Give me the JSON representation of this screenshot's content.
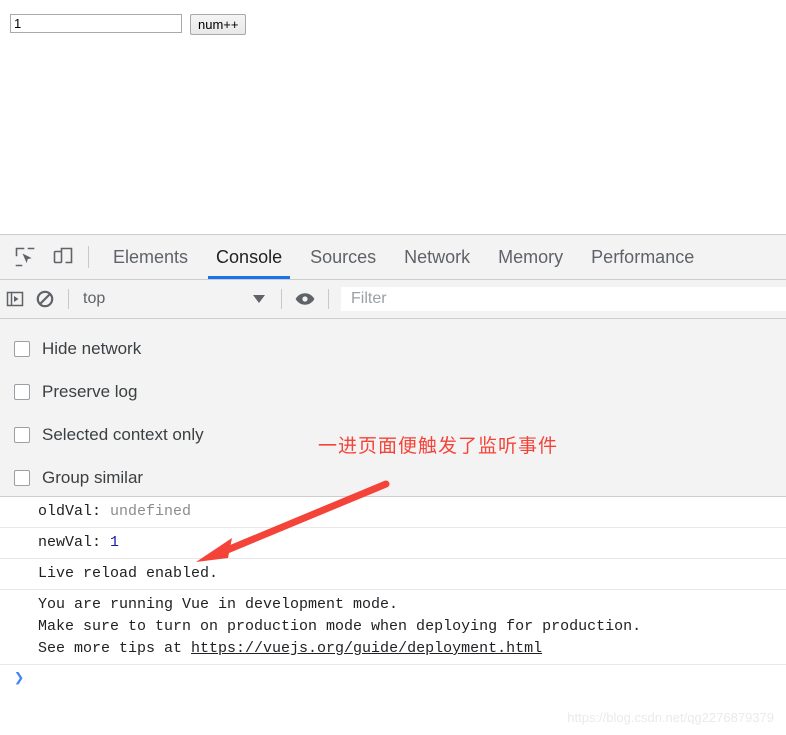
{
  "page": {
    "input_value": "1",
    "input_placeholder": "",
    "button_label": "num++"
  },
  "devtools": {
    "icons": {
      "inspect": "inspect-element-icon",
      "device": "device-toolbar-icon",
      "sidebar": "console-sidebar-icon",
      "clear": "clear-console-icon",
      "eye": "console-settings-eye-icon"
    },
    "tabs": [
      {
        "label": "Elements",
        "active": false
      },
      {
        "label": "Console",
        "active": true
      },
      {
        "label": "Sources",
        "active": false
      },
      {
        "label": "Network",
        "active": false
      },
      {
        "label": "Memory",
        "active": false
      },
      {
        "label": "Performance",
        "active": false
      }
    ],
    "active_tab": "Console",
    "accent_color": "#1a73e8",
    "toolbar": {
      "context_value": "top",
      "filter_placeholder": "Filter",
      "filter_value": ""
    },
    "settings": {
      "checkboxes": [
        {
          "label": "Hide network",
          "checked": false
        },
        {
          "label": "Preserve log",
          "checked": false
        },
        {
          "label": "Selected context only",
          "checked": false
        },
        {
          "label": "Group similar",
          "checked": false
        }
      ]
    },
    "annotation": {
      "text": "一进页面便触发了监听事件",
      "color": "#f4443a"
    },
    "console_messages": [
      {
        "id": "oldval",
        "label": "oldVal: ",
        "value": "undefined",
        "value_kind": "undefined"
      },
      {
        "id": "newval",
        "label": "newVal: ",
        "value": "1",
        "value_kind": "number"
      },
      {
        "id": "livereload",
        "text": "Live reload enabled."
      },
      {
        "id": "vue-warning",
        "line1": "You are running Vue in development mode.",
        "line2": "Make sure to turn on production mode when deploying for production.",
        "line3_prefix": "See more tips at ",
        "line3_link": "https://vuejs.org/guide/deployment.html"
      }
    ],
    "prompt_caret": "❯"
  },
  "watermark": "https://blog.csdn.net/qg2276879379"
}
